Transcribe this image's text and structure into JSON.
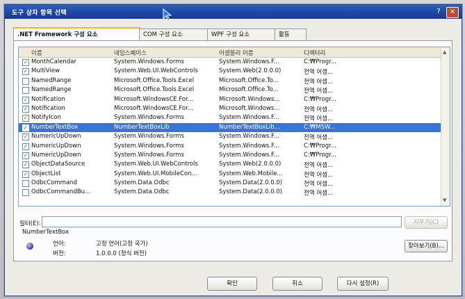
{
  "window": {
    "title": "도구 상자 항목 선택",
    "help": "?",
    "close": "✕"
  },
  "tabs": [
    {
      "label": ".NET Framework 구성 요소"
    },
    {
      "label": "COM 구성 요소"
    },
    {
      "label": "WPF 구성 요소"
    },
    {
      "label": "활동"
    }
  ],
  "list": {
    "columns": [
      "이름",
      "네임스페이스",
      "어셈블리 이름",
      "디렉터리"
    ],
    "rows": [
      {
        "checked": true,
        "name": "MonthCalendar",
        "ns": "System.Windows.Forms",
        "asm": "System.Windows.F...",
        "dir": "C:₩Progr..."
      },
      {
        "checked": true,
        "name": "MultiView",
        "ns": "System.Web.UI.WebControls",
        "asm": "System.Web(2.0.0.0)",
        "dir": "전역 어셈..."
      },
      {
        "checked": false,
        "name": "NamedRange",
        "ns": "Microsoft.Office.Tools.Excel",
        "asm": "Microsoft.Office.To...",
        "dir": "전역 어셈..."
      },
      {
        "checked": false,
        "name": "NamedRange",
        "ns": "Microsoft.Office.Tools.Excel",
        "asm": "Microsoft.Office.To...",
        "dir": "전역 어셈..."
      },
      {
        "checked": true,
        "name": "Notification",
        "ns": "Microsoft.WindowsCE.For...",
        "asm": "Microsoft.Windows...",
        "dir": "C:₩Progr..."
      },
      {
        "checked": true,
        "name": "Notification",
        "ns": "Microsoft.WindowsCE.For...",
        "asm": "Microsoft.Windows...",
        "dir": "전역 어셈..."
      },
      {
        "checked": true,
        "name": "NotifyIcon",
        "ns": "System.Windows.Forms",
        "asm": "System.Windows.F...",
        "dir": "전역 어셈..."
      },
      {
        "checked": true,
        "name": "NumberTextBox",
        "ns": "NumberTextBoxLib",
        "asm": "NumberTextBoxLib...",
        "dir": "C:₩MSW...",
        "selected": true
      },
      {
        "checked": true,
        "name": "NumericUpDown",
        "ns": "System.Windows.Forms",
        "asm": "System.Windows.F...",
        "dir": "전역 어셈..."
      },
      {
        "checked": true,
        "name": "NumericUpDown",
        "ns": "System.Windows.Forms",
        "asm": "System.Windows.F...",
        "dir": "C:₩Progr..."
      },
      {
        "checked": true,
        "name": "NumericUpDown",
        "ns": "System.Windows.Forms",
        "asm": "System.Windows.F...",
        "dir": "C:₩Progr..."
      },
      {
        "checked": true,
        "name": "ObjectDataSource",
        "ns": "System.Web.UI.WebControls",
        "asm": "System.Web(2.0.0.0)",
        "dir": "전역 어셈..."
      },
      {
        "checked": true,
        "name": "ObjectList",
        "ns": "System.Web.UI.MobileCon...",
        "asm": "System.Web.Mobile...",
        "dir": "전역 어셈..."
      },
      {
        "checked": false,
        "name": "OdbcCommand",
        "ns": "System.Data.Odbc",
        "asm": "System.Data(2.0.0.0)",
        "dir": "전역 어셈..."
      },
      {
        "checked": false,
        "name": "OdbcCommandBu...",
        "ns": "System.Data.Odbc",
        "asm": "System.Data(2.0.0.0)",
        "dir": "전역 어셈..."
      }
    ]
  },
  "filter": {
    "label": "필터(E):",
    "value": "",
    "clear_button": "지우기(C)"
  },
  "selected_info": {
    "name": "NumberTextBox",
    "lang_label": "언어:",
    "lang_value": "고정 언어(고정 국가)",
    "version_label": "버전:",
    "version_value": "1.0.0.0 (정식 버전)",
    "browse_button": "찾아보기(B)..."
  },
  "footer": {
    "ok": "확인",
    "cancel": "취소",
    "reset": "다시 설정(R)"
  },
  "colors": {
    "titlebar": "#1f46a0",
    "selection": "#3875d7",
    "active_tab_accent": "#f3b33d"
  },
  "icons": {
    "cursor": "mouse-pointer-icon",
    "info": "globe-icon"
  }
}
